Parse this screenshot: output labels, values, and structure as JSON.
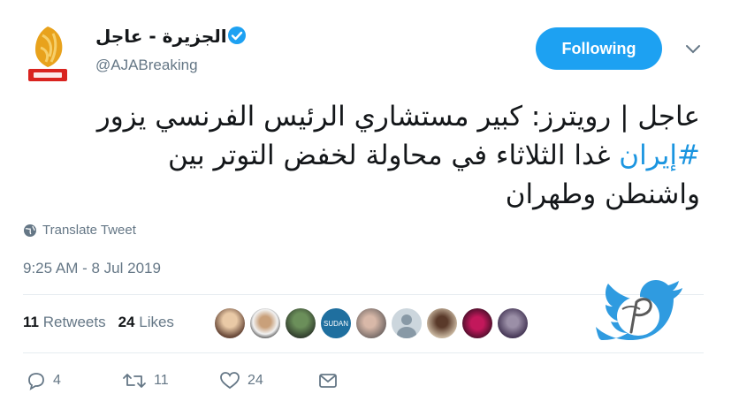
{
  "header": {
    "display_name": "الجزيرة - عاجل",
    "handle": "@AJABreaking",
    "follow_label": "Following",
    "accent": "#1da1f2"
  },
  "tweet": {
    "text_lines": [
      "عاجل | رويترز: كبير مستشاري الرئيس الفرنسي يزور",
      "غدا الثلاثاء في محاولة لخفض التوتر بين",
      "واشنطن وطهران"
    ],
    "hashtag": "#إيران",
    "translate_label": "Translate Tweet",
    "timestamp": "9:25 AM - 8 Jul 2019"
  },
  "stats": {
    "retweets_count": "11",
    "retweets_label": "Retweets",
    "likes_count": "24",
    "likes_label": "Likes",
    "avatar_badge": "SUDAN"
  },
  "actions": {
    "replies": "4",
    "retweets": "11",
    "likes": "24"
  }
}
